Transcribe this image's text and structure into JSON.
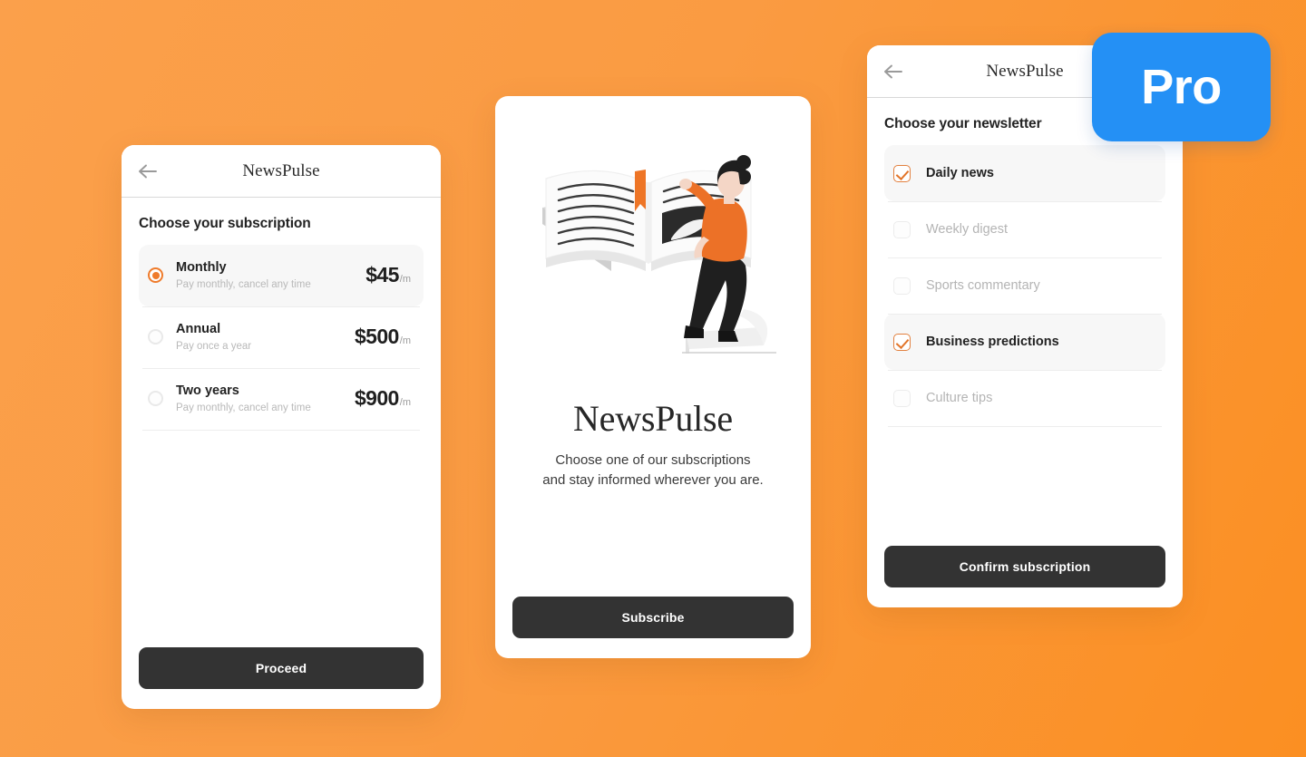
{
  "background": {
    "color_left": "#FBA04B",
    "color_right": "#FB8F22"
  },
  "accent": {
    "orange": "#EF7B2B",
    "blue": "#2490F5",
    "dark": "#333333"
  },
  "badge": {
    "label": "Pro"
  },
  "card_plans": {
    "appbar": {
      "title": "NewsPulse",
      "back_icon": "arrow-left-icon"
    },
    "section_title": "Choose your subscription",
    "plans": [
      {
        "name": "Monthly",
        "subtitle": "Pay monthly, cancel any time",
        "price": "$45",
        "per": "/m",
        "selected": true
      },
      {
        "name": "Annual",
        "subtitle": "Pay once a year",
        "price": "$500",
        "per": "/m",
        "selected": false
      },
      {
        "name": "Two years",
        "subtitle": "Pay monthly, cancel any time",
        "price": "$900",
        "per": "/m",
        "selected": false
      }
    ],
    "cta_label": "Proceed"
  },
  "card_hero": {
    "illustration": "woman-reading-open-book-illustration",
    "brand_title": "NewsPulse",
    "tagline_line1": "Choose one of our subscriptions",
    "tagline_line2": "and stay informed wherever you are.",
    "cta_label": "Subscribe"
  },
  "card_newsletters": {
    "appbar": {
      "title": "NewsPulse",
      "back_icon": "arrow-left-icon"
    },
    "section_title": "Choose your newsletter",
    "items": [
      {
        "label": "Daily news",
        "checked": true
      },
      {
        "label": "Weekly digest",
        "checked": false
      },
      {
        "label": "Sports commentary",
        "checked": false
      },
      {
        "label": "Business predictions",
        "checked": true
      },
      {
        "label": "Culture tips",
        "checked": false
      }
    ],
    "cta_label": "Confirm subscription"
  }
}
